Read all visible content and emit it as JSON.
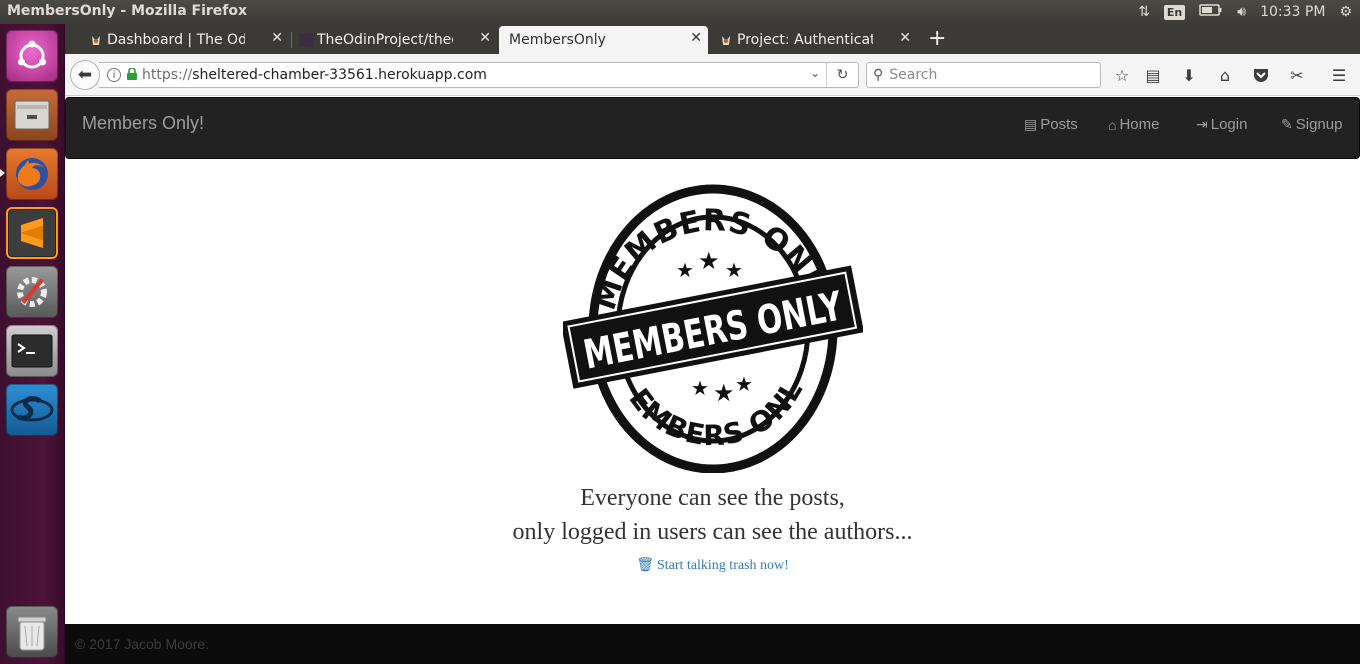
{
  "os": {
    "window_title": "MembersOnly - Mozilla Firefox",
    "keyboard_layout": "En",
    "clock": "10:33 PM",
    "launcher_icons": [
      "ubuntu-dash-icon",
      "files-icon",
      "firefox-icon",
      "sublime-text-icon",
      "system-settings-icon",
      "terminal-icon",
      "app-s-icon",
      "trash-icon"
    ]
  },
  "browser": {
    "tabs": [
      {
        "label": "Dashboard | The Odin Project",
        "active": false
      },
      {
        "label": "TheOdinProject/theodinproject",
        "active": false
      },
      {
        "label": "MembersOnly",
        "active": true
      },
      {
        "label": "Project: Authentication",
        "active": false
      }
    ],
    "url_scheme": "https://",
    "url_host": "sheltered-chamber-33561.herokuapp.com",
    "search_placeholder": "Search"
  },
  "site": {
    "brand": "Members Only!",
    "nav": [
      {
        "label": "Posts",
        "icon": "list-icon"
      },
      {
        "label": "Home",
        "icon": "home-icon"
      },
      {
        "label": "Login",
        "icon": "login-icon"
      },
      {
        "label": "Signup",
        "icon": "pencil-icon"
      }
    ],
    "stamp": {
      "arc_top": "MEMBERS ONLY",
      "banner": "MEMBERS ONLY",
      "arc_bottom": "MEMBERS ONLY"
    },
    "tagline_line1": "Everyone can see the posts,",
    "tagline_line2": "only logged in users can see the authors...",
    "cta": "Start talking trash now!",
    "footer": "© 2017 Jacob Moore."
  }
}
